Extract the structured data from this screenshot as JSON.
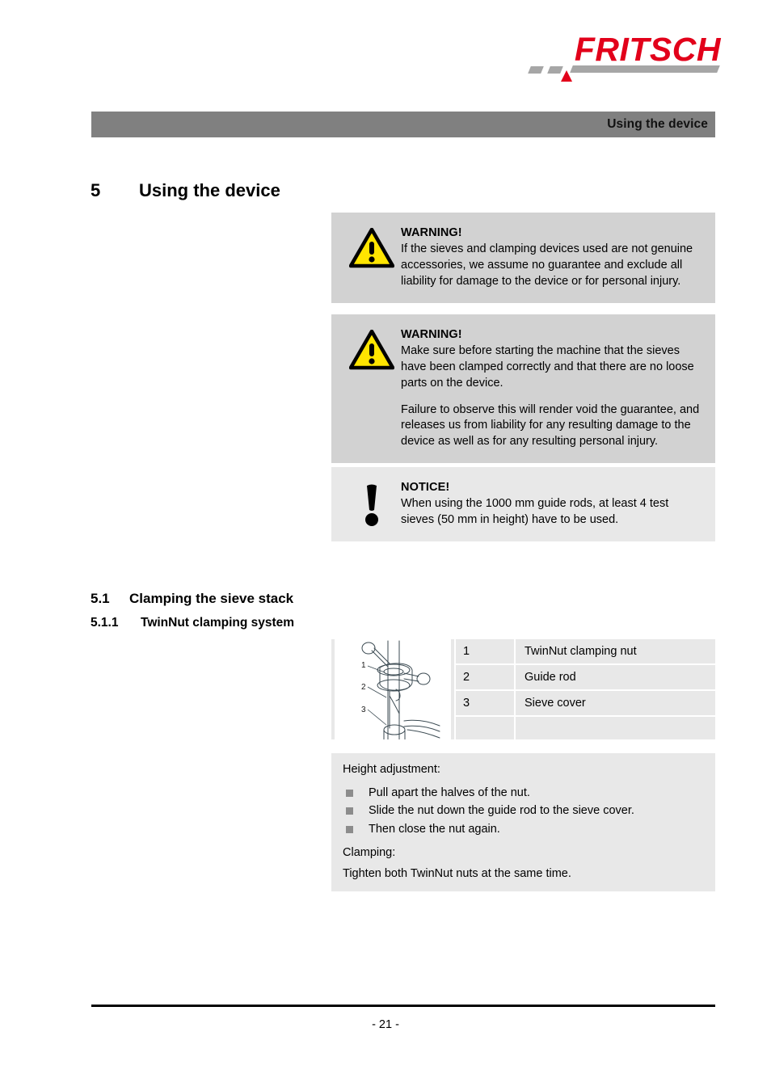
{
  "brand": {
    "logo_text": "FRITSCH",
    "logo_color": "#e2001a",
    "bar_color": "#a6a6a6"
  },
  "running_header": {
    "title": "Using the device",
    "background": "#808080"
  },
  "chapter": {
    "number": "5",
    "title": "Using the device"
  },
  "admonitions": [
    {
      "kind": "warning",
      "icon": "warning-triangle-icon",
      "title": "WARNING!",
      "paragraphs": [
        "If the sieves and clamping devices used are not genuine accessories, we assume no guarantee and exclude all liability for damage to the device or for personal injury."
      ],
      "background": "#d2d2d2",
      "icon_color": "#ffe500"
    },
    {
      "kind": "warning",
      "icon": "warning-triangle-icon",
      "title": "WARNING!",
      "paragraphs": [
        "Make sure before starting the machine that the sieves have been clamped correctly and that there are no loose parts on the device.",
        "Failure to observe this will render void the guarantee, and releases us from liability for any resulting damage to the device as well as for any resulting personal injury."
      ],
      "background": "#d2d2d2",
      "icon_color": "#ffe500"
    },
    {
      "kind": "notice",
      "icon": "exclamation-mark-icon",
      "title": "NOTICE!",
      "paragraphs": [
        "When using the 1000 mm guide rods, at least 4 test sieves (50 mm in height) have to be used."
      ],
      "background": "#e8e8e8",
      "icon_color": "#000000"
    }
  ],
  "sections": [
    {
      "number": "5.1",
      "title": "Clamping the sieve stack"
    },
    {
      "number": "5.1.1",
      "title": "TwinNut clamping system"
    }
  ],
  "figure": {
    "illustration_name": "twinnut-clamping-nut-illustration",
    "callouts": [
      "1",
      "2",
      "3"
    ],
    "legend": [
      {
        "key": "1",
        "value": "TwinNut clamping nut"
      },
      {
        "key": "2",
        "value": "Guide rod"
      },
      {
        "key": "3",
        "value": "Sieve cover"
      }
    ]
  },
  "procedure": {
    "lead": "Height adjustment:",
    "steps": [
      "Pull apart the halves of the nut.",
      "Slide the nut down the guide rod to the sieve cover.",
      "Then close the nut again."
    ],
    "sub_lead": "Clamping:",
    "final": "Tighten both TwinNut nuts at the same time."
  },
  "footer": {
    "page_label": "- 21 -"
  }
}
